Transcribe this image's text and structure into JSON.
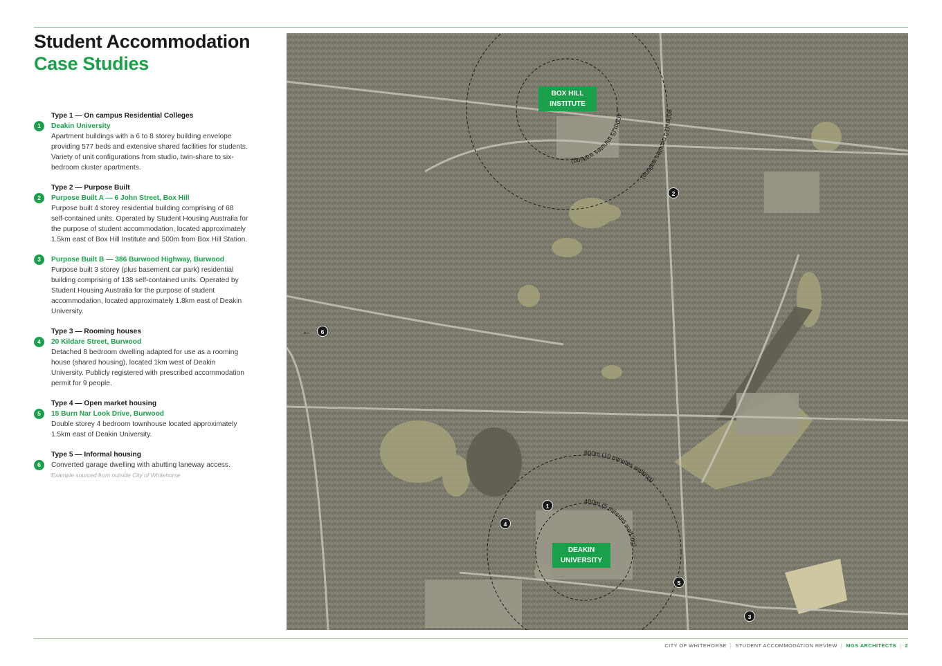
{
  "title": {
    "line1": "Student Accommodation",
    "line2": "Case Studies"
  },
  "cases": [
    {
      "num": "1",
      "type": "Type 1 — On campus Residential Colleges",
      "name": "Deakin University",
      "desc": "Apartment buildings with a 6 to 8 storey building envelope providing 577 beds and extensive shared facilities for students. Variety of unit configurations from studio, twin-share to six-bedroom cluster apartments."
    },
    {
      "num": "2",
      "type": "Type 2 — Purpose Built",
      "name": "Purpose Built A — 6 John Street, Box Hill",
      "desc": "Purpose built 4 storey residential building comprising of 68 self-contained units. Operated by Student Housing Australia for the purpose of student accommodation, located approximately 1.5km east of Box Hill Institute and 500m from Box Hill Station."
    },
    {
      "num": "3",
      "type": "",
      "name": "Purpose Built B — 386 Burwood Highway, Burwood",
      "desc": "Purpose built 3 storey (plus basement car park) residential building comprising of 138 self-contained units. Operated by Student Housing Australia for the purpose of student accommodation, located approximately 1.8km east of Deakin University."
    },
    {
      "num": "4",
      "type": "Type 3 — Rooming houses",
      "name": "20 Kildare Street, Burwood",
      "desc": "Detached 8 bedroom dwelling adapted for use as a rooming house (shared housing), located 1km west of Deakin University. Publicly registered with prescribed accommodation permit for 9 people."
    },
    {
      "num": "5",
      "type": "Type 4 — Open market housing",
      "name": "15 Burn Nar Look Drive, Burwood",
      "desc": "Double storey 4 bedroom townhouse located approximately 1.5km east of Deakin University."
    },
    {
      "num": "6",
      "type": "Type 5 — Informal housing",
      "name": "",
      "desc": "Converted garage dwelling with abutting laneway access.",
      "note": "Example sourced from outside City of Whitehorse"
    }
  ],
  "map": {
    "box_hill": {
      "line1": "BOX HILL",
      "line2": "INSTITUTE"
    },
    "deakin": {
      "line1": "DEAKIN",
      "line2": "UNIVERSITY"
    },
    "radius_400": "400m (5 minutes walking)",
    "radius_800": "800m (10 minutes walking)",
    "arrow": "←",
    "markers": [
      "1",
      "2",
      "3",
      "4",
      "5",
      "6"
    ],
    "colors": {
      "aerial": "#7b7a6c",
      "parkland": "#a5a27a",
      "road": "#c4c2b6",
      "ring": "#1a1a1a"
    }
  },
  "footer": {
    "council": "CITY OF WHITEHORSE",
    "report": "STUDENT ACCOMMODATION REVIEW",
    "firm": "MGS ARCHITECTS",
    "page": "2",
    "separator": "|"
  },
  "colors": {
    "accent": "#1aa04a",
    "rule": "#8fc89f",
    "text": "#1a1a1a"
  }
}
